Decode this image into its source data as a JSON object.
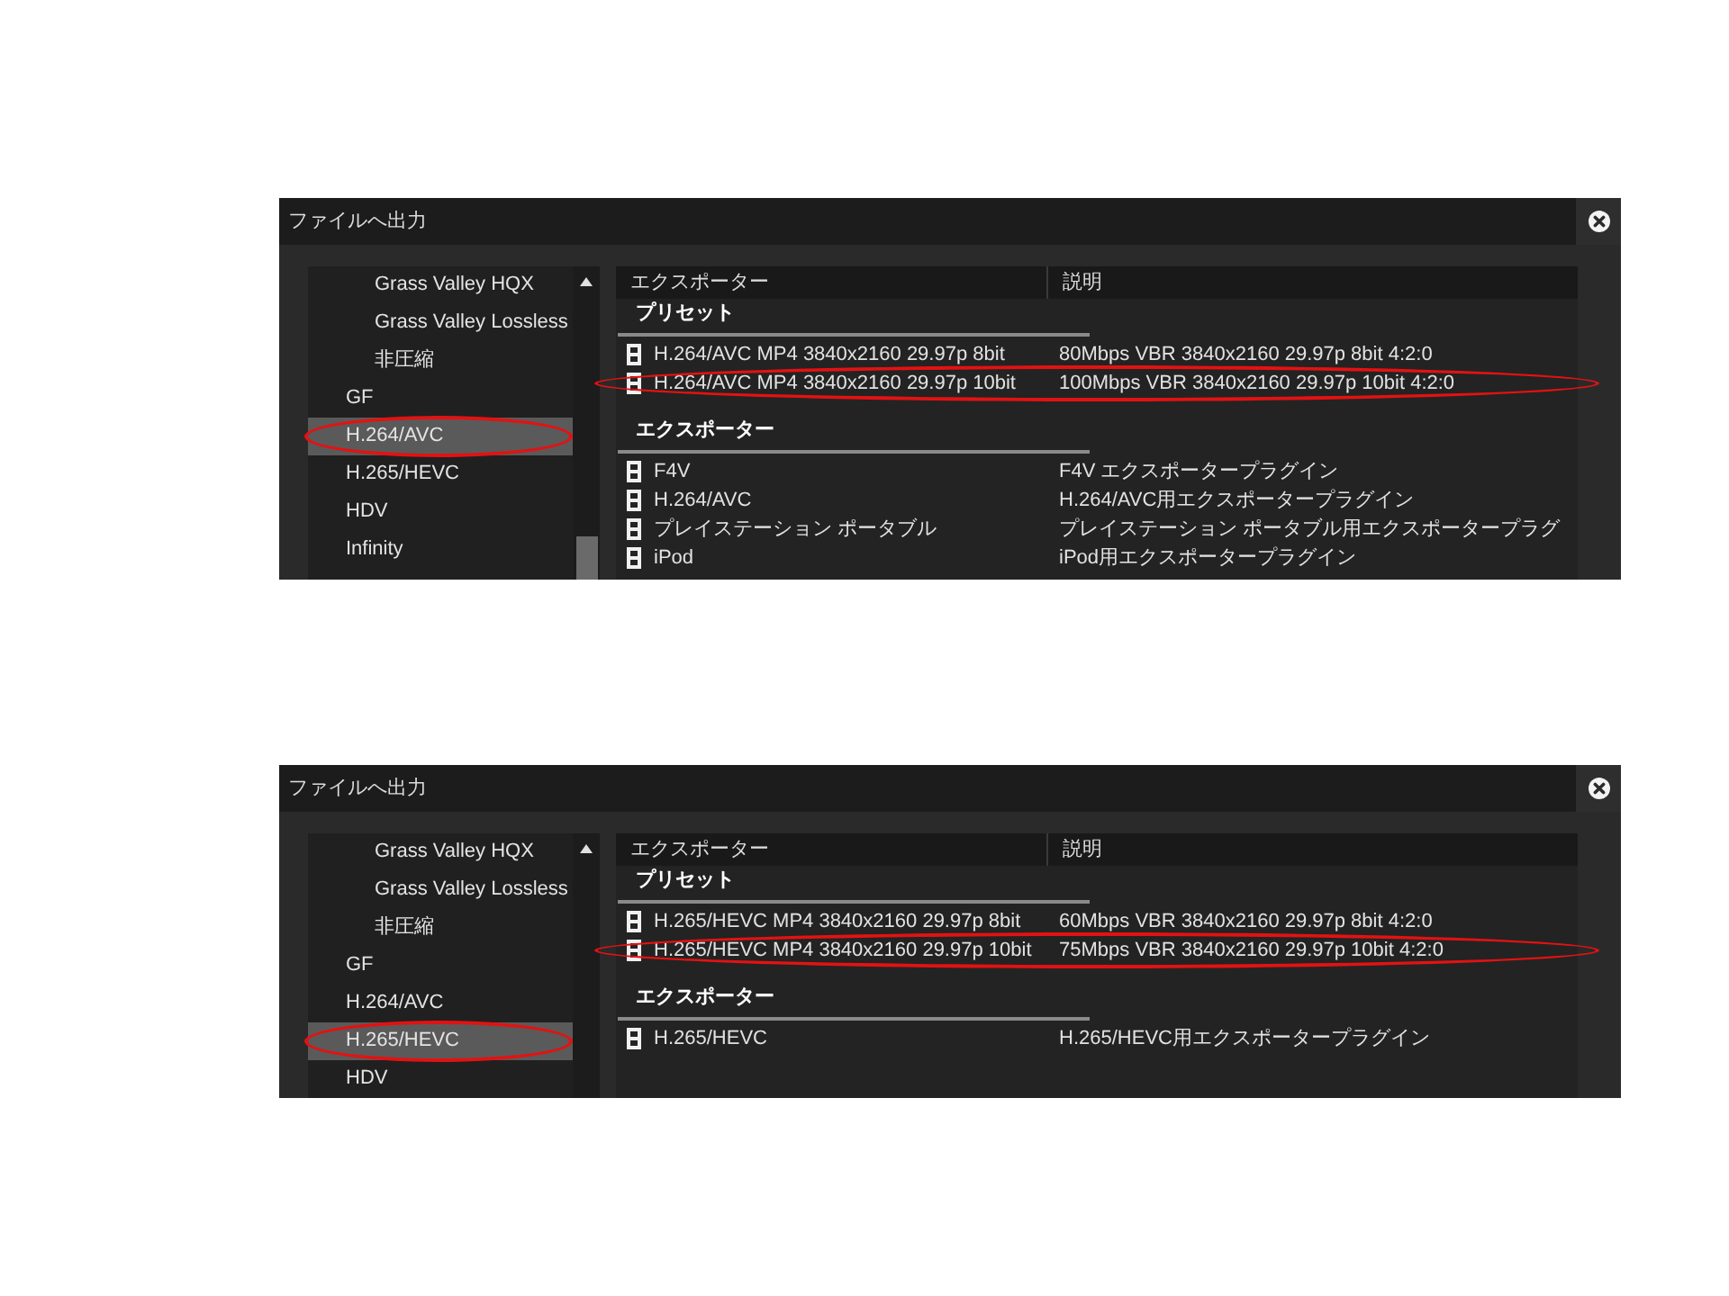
{
  "dialogs": [
    {
      "title": "ファイルへ出力",
      "tree": {
        "items": [
          {
            "children": [
              {
                "label": "Grass Valley HQX",
                "selected": false,
                "circled": false
              },
              {
                "label": "Grass Valley Lossless",
                "selected": false,
                "circled": false
              },
              {
                "label": "非圧縮",
                "selected": false,
                "circled": false
              }
            ]
          },
          {
            "label": "GF",
            "selected": false,
            "circled": false
          },
          {
            "label": "H.264/AVC",
            "selected": true,
            "circled": true
          },
          {
            "label": "H.265/HEVC",
            "selected": false,
            "circled": false
          },
          {
            "label": "HDV",
            "selected": false,
            "circled": false
          },
          {
            "label": "Infinity",
            "selected": false,
            "circled": false
          }
        ]
      },
      "columns": [
        "エクスポーター",
        "説明"
      ],
      "groups": [
        {
          "heading": "プリセット",
          "rows": [
            {
              "name": "H.264/AVC MP4 3840x2160 29.97p 8bit",
              "description": "80Mbps VBR 3840x2160 29.97p 8bit 4:2:0",
              "circled": false
            },
            {
              "name": "H.264/AVC MP4 3840x2160 29.97p 10bit",
              "description": "100Mbps VBR 3840x2160 29.97p 10bit 4:2:0",
              "circled": true
            }
          ]
        },
        {
          "heading": "エクスポーター",
          "rows": [
            {
              "name": "F4V",
              "description": "F4V エクスポータープラグイン",
              "circled": false
            },
            {
              "name": "H.264/AVC",
              "description": "H.264/AVC用エクスポータープラグイン",
              "circled": false
            },
            {
              "name": "プレイステーション ポータブル",
              "description": "プレイステーション ポータブル用エクスポータープラグ",
              "circled": false
            },
            {
              "name": "iPod",
              "description": "iPod用エクスポータープラグイン",
              "circled": false
            }
          ]
        }
      ]
    },
    {
      "title": "ファイルへ出力",
      "tree": {
        "items": [
          {
            "children": [
              {
                "label": "Grass Valley HQX",
                "selected": false,
                "circled": false
              },
              {
                "label": "Grass Valley Lossless",
                "selected": false,
                "circled": false
              },
              {
                "label": "非圧縮",
                "selected": false,
                "circled": false
              }
            ]
          },
          {
            "label": "GF",
            "selected": false,
            "circled": false
          },
          {
            "label": "H.264/AVC",
            "selected": false,
            "circled": false
          },
          {
            "label": "H.265/HEVC",
            "selected": true,
            "circled": true
          },
          {
            "label": "HDV",
            "selected": false,
            "circled": false
          }
        ]
      },
      "columns": [
        "エクスポーター",
        "説明"
      ],
      "groups": [
        {
          "heading": "プリセット",
          "rows": [
            {
              "name": "H.265/HEVC MP4 3840x2160 29.97p 8bit",
              "description": "60Mbps VBR 3840x2160 29.97p 8bit 4:2:0",
              "circled": false
            },
            {
              "name": "H.265/HEVC MP4 3840x2160 29.97p 10bit",
              "description": "75Mbps VBR 3840x2160 29.97p 10bit 4:2:0",
              "circled": true
            }
          ]
        },
        {
          "heading": "エクスポーター",
          "rows": [
            {
              "name": "H.265/HEVC",
              "description": "H.265/HEVC用エクスポータープラグイン",
              "circled": false
            }
          ]
        }
      ]
    }
  ]
}
